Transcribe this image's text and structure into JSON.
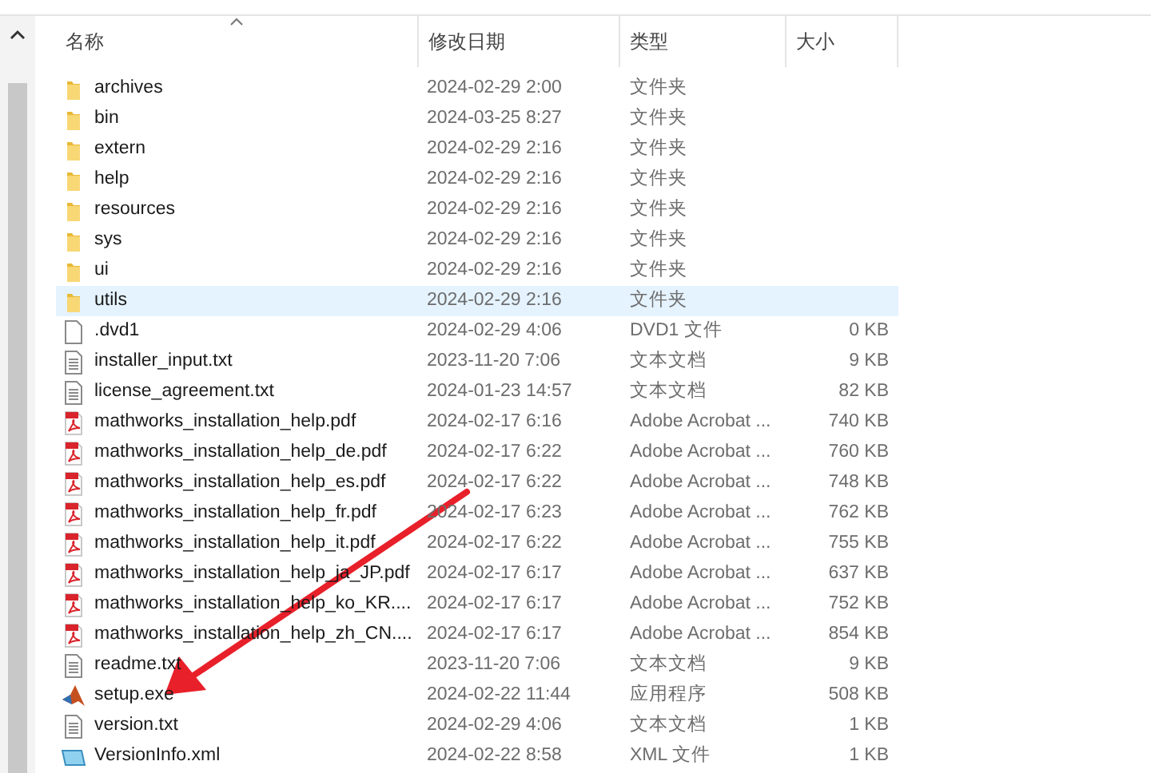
{
  "columns": [
    {
      "label": "名称",
      "sorted": true
    },
    {
      "label": "修改日期",
      "sorted": false
    },
    {
      "label": "类型",
      "sorted": false
    },
    {
      "label": "大小",
      "sorted": false
    }
  ],
  "rows": [
    {
      "kind": "folder",
      "name": "archives",
      "date": "2024-02-29 2:00",
      "type": "文件夹",
      "selected": false
    },
    {
      "kind": "folder",
      "name": "bin",
      "date": "2024-03-25 8:27",
      "type": "文件夹",
      "selected": false
    },
    {
      "kind": "folder",
      "name": "extern",
      "date": "2024-02-29 2:16",
      "type": "文件夹",
      "selected": false
    },
    {
      "kind": "folder",
      "name": "help",
      "date": "2024-02-29 2:16",
      "type": "文件夹",
      "selected": false
    },
    {
      "kind": "folder",
      "name": "resources",
      "date": "2024-02-29 2:16",
      "type": "文件夹",
      "selected": false
    },
    {
      "kind": "folder",
      "name": "sys",
      "date": "2024-02-29 2:16",
      "type": "文件夹",
      "selected": false
    },
    {
      "kind": "folder",
      "name": "ui",
      "date": "2024-02-29 2:16",
      "type": "文件夹",
      "selected": false
    },
    {
      "kind": "folder",
      "name": "utils",
      "date": "2024-02-29 2:16",
      "type": "文件夹",
      "selected": true
    },
    {
      "kind": "blank",
      "name": ".dvd1",
      "date": "2024-02-29 4:06",
      "type": "DVD1 文件",
      "size": "0 KB",
      "selected": false
    },
    {
      "kind": "text",
      "name": "installer_input.txt",
      "date": "2023-11-20 7:06",
      "type": "文本文档",
      "size": "9 KB",
      "selected": false
    },
    {
      "kind": "text",
      "name": "license_agreement.txt",
      "date": "2024-01-23 14:57",
      "type": "文本文档",
      "size": "82 KB",
      "selected": false
    },
    {
      "kind": "pdf",
      "name": "mathworks_installation_help.pdf",
      "date": "2024-02-17 6:16",
      "type": "Adobe Acrobat ...",
      "size": "740 KB",
      "selected": false
    },
    {
      "kind": "pdf",
      "name": "mathworks_installation_help_de.pdf",
      "date": "2024-02-17 6:22",
      "type": "Adobe Acrobat ...",
      "size": "760 KB",
      "selected": false
    },
    {
      "kind": "pdf",
      "name": "mathworks_installation_help_es.pdf",
      "date": "2024-02-17 6:22",
      "type": "Adobe Acrobat ...",
      "size": "748 KB",
      "selected": false
    },
    {
      "kind": "pdf",
      "name": "mathworks_installation_help_fr.pdf",
      "date": "2024-02-17 6:23",
      "type": "Adobe Acrobat ...",
      "size": "762 KB",
      "selected": false
    },
    {
      "kind": "pdf",
      "name": "mathworks_installation_help_it.pdf",
      "date": "2024-02-17 6:22",
      "type": "Adobe Acrobat ...",
      "size": "755 KB",
      "selected": false
    },
    {
      "kind": "pdf",
      "name": "mathworks_installation_help_ja_JP.pdf",
      "date": "2024-02-17 6:17",
      "type": "Adobe Acrobat ...",
      "size": "637 KB",
      "selected": false
    },
    {
      "kind": "pdf",
      "name": "mathworks_installation_help_ko_KR....",
      "date": "2024-02-17 6:17",
      "type": "Adobe Acrobat ...",
      "size": "752 KB",
      "selected": false
    },
    {
      "kind": "pdf",
      "name": "mathworks_installation_help_zh_CN....",
      "date": "2024-02-17 6:17",
      "type": "Adobe Acrobat ...",
      "size": "854 KB",
      "selected": false
    },
    {
      "kind": "text",
      "name": "readme.txt",
      "date": "2023-11-20 7:06",
      "type": "文本文档",
      "size": "9 KB",
      "selected": false
    },
    {
      "kind": "exe",
      "name": "setup.exe",
      "date": "2024-02-22 11:44",
      "type": "应用程序",
      "size": "508 KB",
      "selected": false
    },
    {
      "kind": "text",
      "name": "version.txt",
      "date": "2024-02-29 4:06",
      "type": "文本文档",
      "size": "1 KB",
      "selected": false
    },
    {
      "kind": "xml",
      "name": "VersionInfo.xml",
      "date": "2024-02-22 8:58",
      "type": "XML 文件",
      "size": "1 KB",
      "selected": false
    }
  ]
}
